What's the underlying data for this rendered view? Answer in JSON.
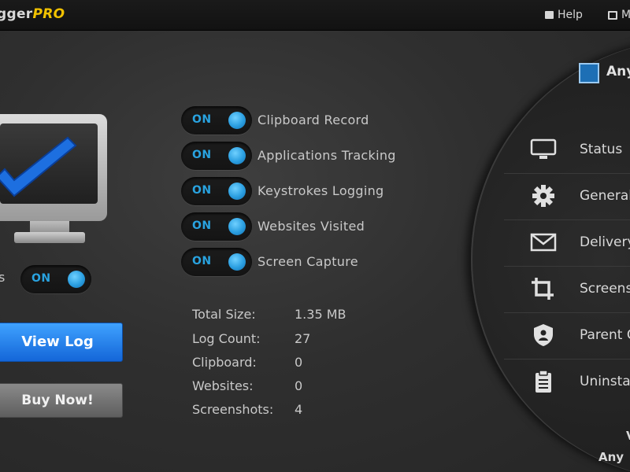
{
  "window": {
    "title_part1": "gger",
    "title_part2": "PRO",
    "help_label": "Help",
    "second_link_label": "M"
  },
  "monitor": {
    "status_label": "s",
    "toggle_label": "ON"
  },
  "features": [
    {
      "label": "Clipboard Record",
      "toggle": "ON"
    },
    {
      "label": "Applications Tracking",
      "toggle": "ON"
    },
    {
      "label": "Keystrokes Logging",
      "toggle": "ON"
    },
    {
      "label": "Websites Visited",
      "toggle": "ON"
    },
    {
      "label": "Screen Capture",
      "toggle": "ON"
    }
  ],
  "buttons": {
    "view_log": "View Log",
    "buy_now": "Buy Now!"
  },
  "stats": [
    {
      "label": "Total Size:",
      "value": "1.35 MB"
    },
    {
      "label": "Log Count:",
      "value": "27"
    },
    {
      "label": "Clipboard:",
      "value": "0"
    },
    {
      "label": "Websites:",
      "value": "0"
    },
    {
      "label": "Screenshots:",
      "value": "4"
    }
  ],
  "sidebar": {
    "account_label": "Any",
    "items": [
      {
        "label": "Status",
        "icon": "monitor-icon"
      },
      {
        "label": "General",
        "icon": "gear-icon"
      },
      {
        "label": "Delivery",
        "icon": "envelope-icon"
      },
      {
        "label": "Screens",
        "icon": "crop-icon"
      },
      {
        "label": "Parent C",
        "icon": "shield-icon"
      },
      {
        "label": "Uninsta",
        "icon": "clipboard-icon"
      }
    ],
    "footer_line1": "V",
    "footer_line2": "Any"
  },
  "colors": {
    "accent_blue": "#2a9ee0",
    "pro_yellow": "#f2c200",
    "button_blue": "#1466d8",
    "background": "#2f2f2f"
  }
}
